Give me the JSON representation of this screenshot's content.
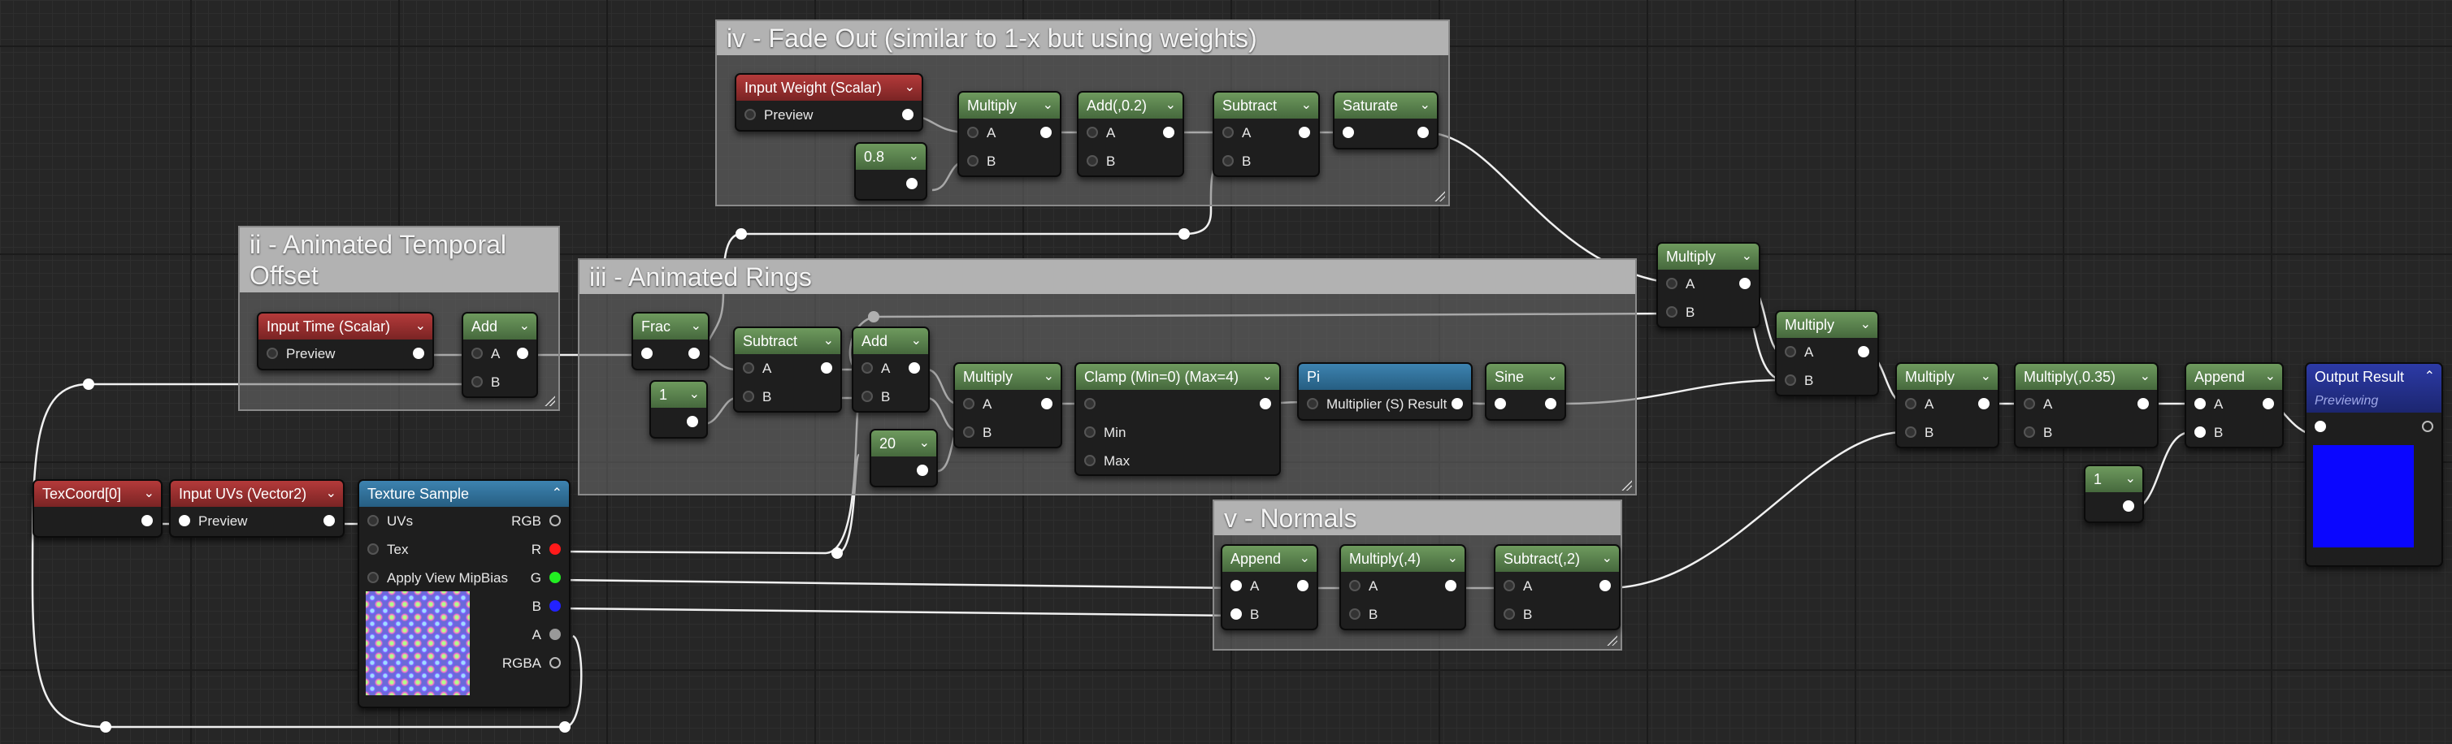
{
  "comments": {
    "fade_out": "iv - Fade Out (similar to 1-x but using weights)",
    "temporal_offset": "ii - Animated Temporal Offset",
    "rings": "iii - Animated Rings",
    "normals": "v - Normals"
  },
  "nodes": {
    "input_weight": {
      "title": "Input Weight (Scalar)",
      "pin": "Preview"
    },
    "const_08": {
      "title": "0.8"
    },
    "multiply_fade": {
      "title": "Multiply",
      "a": "A",
      "b": "B"
    },
    "add_02": {
      "title": "Add(,0.2)",
      "a": "A",
      "b": "B"
    },
    "subtract_fade": {
      "title": "Subtract",
      "a": "A",
      "b": "B"
    },
    "saturate": {
      "title": "Saturate"
    },
    "input_time": {
      "title": "Input Time (Scalar)",
      "pin": "Preview"
    },
    "add_time": {
      "title": "Add",
      "a": "A",
      "b": "B"
    },
    "frac": {
      "title": "Frac"
    },
    "const_1_rings": {
      "title": "1"
    },
    "subtract_rings": {
      "title": "Subtract",
      "a": "A",
      "b": "B"
    },
    "add_rings": {
      "title": "Add",
      "a": "A",
      "b": "B"
    },
    "const_20": {
      "title": "20"
    },
    "multiply_rings": {
      "title": "Multiply",
      "a": "A",
      "b": "B"
    },
    "clamp": {
      "title": "Clamp (Min=0) (Max=4)",
      "min": "Min",
      "max": "Max"
    },
    "pi": {
      "title": "Pi",
      "pin": "Multiplier (S) Result"
    },
    "sine": {
      "title": "Sine"
    },
    "multiply_top": {
      "title": "Multiply",
      "a": "A",
      "b": "B"
    },
    "multiply_mid": {
      "title": "Multiply",
      "a": "A",
      "b": "B"
    },
    "multiply_3": {
      "title": "Multiply",
      "a": "A",
      "b": "B"
    },
    "multiply_035": {
      "title": "Multiply(,0.35)",
      "a": "A",
      "b": "B"
    },
    "append_out": {
      "title": "Append",
      "a": "A",
      "b": "B"
    },
    "const_1_out": {
      "title": "1"
    },
    "output": {
      "title": "Output Result",
      "status": "Previewing"
    },
    "texcoord": {
      "title": "TexCoord[0]"
    },
    "input_uvs": {
      "title": "Input UVs (Vector2)",
      "pin": "Preview"
    },
    "texture_sample": {
      "title": "Texture Sample",
      "uvs": "UVs",
      "tex": "Tex",
      "mip": "Apply View MipBias",
      "rgb": "RGB",
      "r": "R",
      "g": "G",
      "b": "B",
      "a": "A",
      "rgba": "RGBA"
    },
    "append_normals": {
      "title": "Append",
      "a": "A",
      "b": "B"
    },
    "multiply_4": {
      "title": "Multiply(,4)",
      "a": "A",
      "b": "B"
    },
    "subtract_2": {
      "title": "Subtract(,2)",
      "a": "A",
      "b": "B"
    }
  },
  "colors": {
    "preview_blue": "#0a06ff",
    "pin_r": "#ff1a1a",
    "pin_g": "#22ee22",
    "pin_b": "#2222ff"
  }
}
